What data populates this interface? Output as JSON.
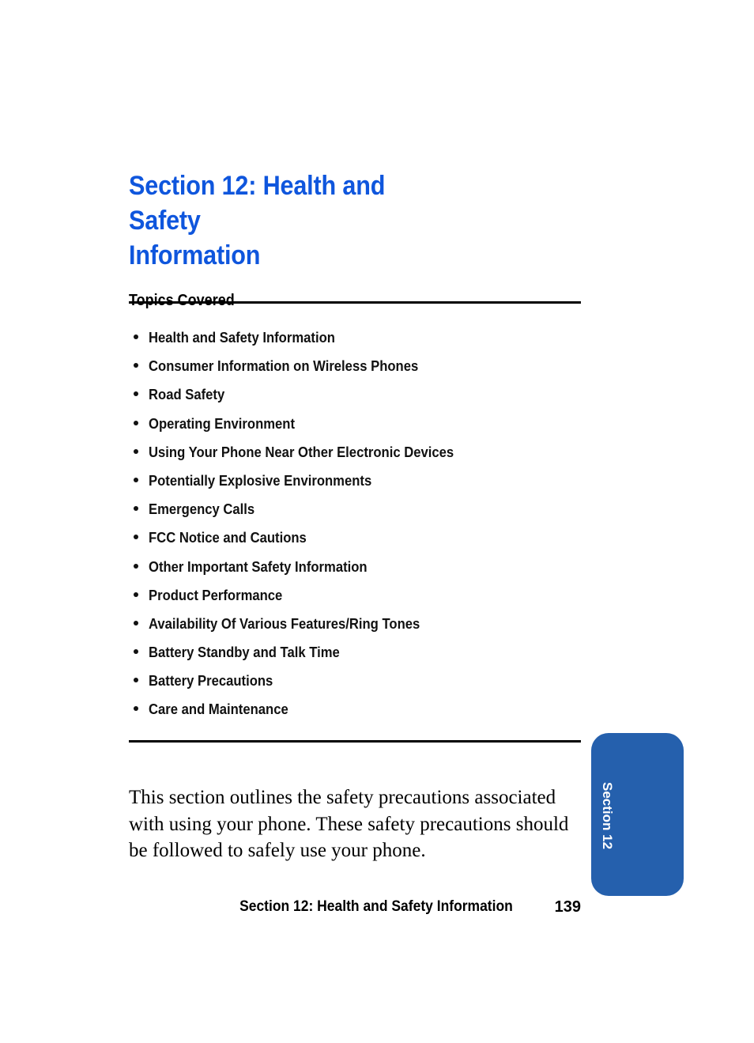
{
  "document": {
    "title_line1": "Section 12:  Health and Safety",
    "title_line2": "Information",
    "title_color": "#0f56dd"
  },
  "topics": {
    "heading": "Topics Covered",
    "items": [
      "Health and Safety Information",
      "Consumer Information on Wireless Phones",
      "Road Safety",
      "Operating Environment",
      "Using Your Phone Near Other Electronic Devices",
      "Potentially Explosive Environments",
      "Emergency Calls",
      "FCC Notice and Cautions",
      "Other Important Safety Information",
      "Product Performance",
      "Availability Of Various Features/Ring Tones",
      "Battery Standby and Talk Time",
      "Battery Precautions",
      "Care and Maintenance"
    ]
  },
  "intro": {
    "paragraph": "This section outlines the safety precautions associated with using your phone. These safety precautions should be followed to safely use your phone."
  },
  "side_tab": {
    "label": "Section 12",
    "color": "#2560ad",
    "text_color": "#ffffff"
  },
  "footer": {
    "section_title": "Section 12: Health and Safety Information",
    "page_number": "139"
  }
}
